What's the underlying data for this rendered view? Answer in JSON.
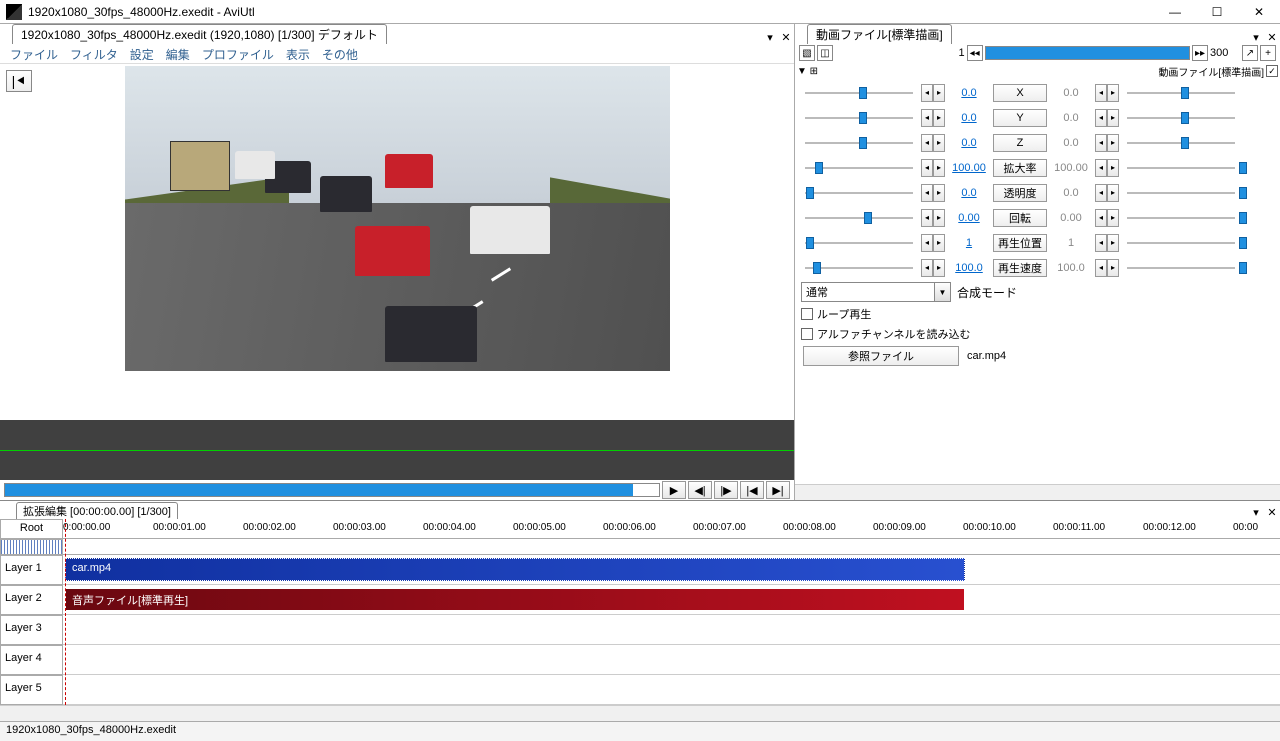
{
  "window": {
    "title": "1920x1080_30fps_48000Hz.exedit - AviUtl"
  },
  "preview_tab": "1920x1080_30fps_48000Hz.exedit (1920,1080)  [1/300]  デフォルト",
  "menu": {
    "file": "ファイル",
    "filter": "フィルタ",
    "settings": "設定",
    "edit": "編集",
    "profile": "プロファイル",
    "view": "表示",
    "other": "その他"
  },
  "properties": {
    "tab": "動画ファイル[標準描画]",
    "header_label": "動画ファイル[標準描画]",
    "frame_start": "1",
    "frame_end": "300",
    "rows": [
      {
        "val_l": "0.0",
        "label": "X",
        "val_r": "0.0"
      },
      {
        "val_l": "0.0",
        "label": "Y",
        "val_r": "0.0"
      },
      {
        "val_l": "0.0",
        "label": "Z",
        "val_r": "0.0"
      },
      {
        "val_l": "100.00",
        "label": "拡大率",
        "val_r": "100.00"
      },
      {
        "val_l": "0.0",
        "label": "透明度",
        "val_r": "0.0"
      },
      {
        "val_l": "0.00",
        "label": "回転",
        "val_r": "0.00"
      },
      {
        "val_l": "1",
        "label": "再生位置",
        "val_r": "1"
      },
      {
        "val_l": "100.0",
        "label": "再生速度",
        "val_r": "100.0"
      }
    ],
    "blend_mode": "通常",
    "blend_label": "合成モード",
    "loop": "ループ再生",
    "alpha": "アルファチャンネルを読み込む",
    "ref_button": "参照ファイル",
    "filename": "car.mp4"
  },
  "timeline": {
    "tab": "拡張編集 [00:00:00.00] [1/300]",
    "root": "Root",
    "layers": [
      "Layer 1",
      "Layer 2",
      "Layer 3",
      "Layer 4",
      "Layer 5"
    ],
    "timecodes": [
      "0:00:00.00",
      "00:00:01.00",
      "00:00:02.00",
      "00:00:03.00",
      "00:00:04.00",
      "00:00:05.00",
      "00:00:06.00",
      "00:00:07.00",
      "00:00:08.00",
      "00:00:09.00",
      "00:00:10.00",
      "00:00:11.00",
      "00:00:12.00",
      "00:00"
    ],
    "clip_video": "car.mp4",
    "clip_audio": "音声ファイル[標準再生]"
  },
  "statusbar": "1920x1080_30fps_48000Hz.exedit"
}
